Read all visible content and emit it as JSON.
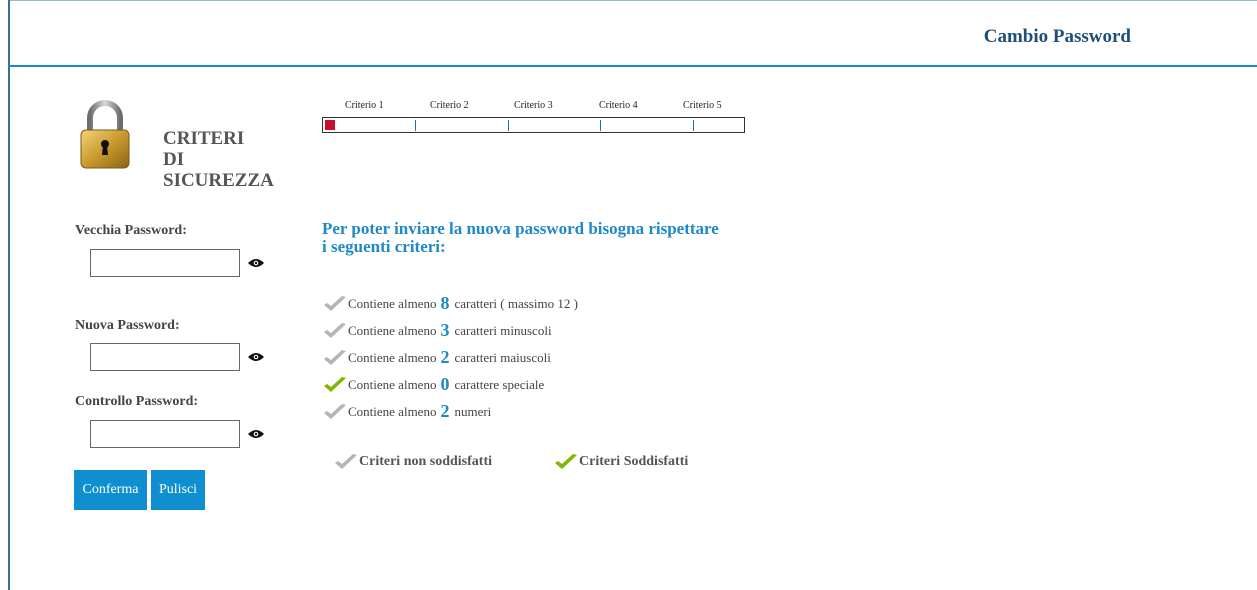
{
  "header": {
    "title": "Cambio Password"
  },
  "sidebar": {
    "title_lines": [
      "CRITERI",
      "DI",
      "SICUREZZA"
    ],
    "fields": [
      {
        "label": "Vecchia Password:",
        "value": "",
        "placeholder": ""
      },
      {
        "label": "Nuova Password:",
        "value": "",
        "placeholder": ""
      },
      {
        "label": "Controllo Password:",
        "value": "",
        "placeholder": ""
      }
    ],
    "buttons": {
      "confirm": "Conferma",
      "clear": "Pulisci"
    }
  },
  "strength": {
    "criteria_labels": [
      "Criterio 1",
      "Criterio 2",
      "Criterio 3",
      "Criterio 4",
      "Criterio 5"
    ],
    "level": 1,
    "max_level": 5,
    "fill_color": "#c8102e"
  },
  "criteria": {
    "intro": "Per poter inviare la nuova password bisogna rispettare i seguenti criteri:",
    "items": [
      {
        "prefix": "Contiene almeno",
        "count": "8",
        "suffix": "caratteri ( massimo 12 )",
        "satisfied": false
      },
      {
        "prefix": "Contiene almeno",
        "count": "3",
        "suffix": "caratteri minuscoli",
        "satisfied": false
      },
      {
        "prefix": "Contiene almeno",
        "count": "2",
        "suffix": "caratteri maiuscoli",
        "satisfied": false
      },
      {
        "prefix": "Contiene almeno",
        "count": "0",
        "suffix": "carattere speciale",
        "satisfied": true
      },
      {
        "prefix": "Contiene almeno",
        "count": "2",
        "suffix": "numeri",
        "satisfied": false
      }
    ]
  },
  "legend": {
    "not_satisfied": "Criteri non soddisfatti",
    "satisfied": "Criteri Soddisfatti"
  },
  "colors": {
    "accent": "#1e88c8",
    "button": "#0f8fd0",
    "check_ok": "#7fb800",
    "check_no": "#b5b5b5"
  },
  "icons": {
    "lock": "padlock-icon",
    "eye": "eye-icon",
    "check": "checkmark-icon"
  }
}
